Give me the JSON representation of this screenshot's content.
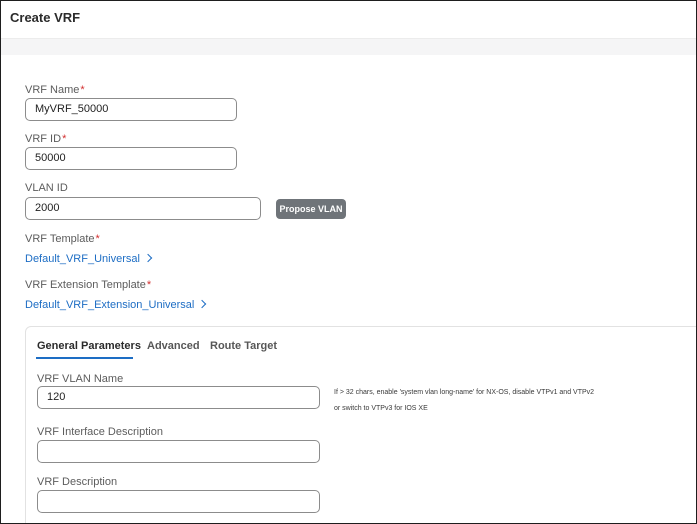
{
  "dialog": {
    "title": "Create VRF"
  },
  "form": {
    "vrf_name": {
      "label": "VRF Name",
      "required_mark": "*",
      "value": "MyVRF_50000"
    },
    "vrf_id": {
      "label": "VRF ID",
      "required_mark": "*",
      "value": "50000"
    },
    "vlan_id": {
      "label": "VLAN ID",
      "value": "2000"
    },
    "propose_vlan_button": "Propose VLAN",
    "vrf_template": {
      "label": "VRF Template",
      "required_mark": "*",
      "link": "Default_VRF_Universal"
    },
    "vrf_extension_template": {
      "label": "VRF Extension Template",
      "required_mark": "*",
      "link": "Default_VRF_Extension_Universal"
    }
  },
  "tabs": [
    {
      "label": "General Parameters",
      "active": true
    },
    {
      "label": "Advanced",
      "active": false
    },
    {
      "label": "Route Target",
      "active": false
    }
  ],
  "general": {
    "vrf_vlan_name": {
      "label": "VRF VLAN Name",
      "value": "120"
    },
    "vlan_name_hint_line1": "If > 32 chars, enable 'system vlan long-name' for NX-OS, disable VTPv1 and VTPv2",
    "vlan_name_hint_line2": "or switch to VTPv3 for IOS XE",
    "vrf_interface_description": {
      "label": "VRF Interface Description",
      "value": ""
    },
    "vrf_description": {
      "label": "VRF Description",
      "value": ""
    }
  },
  "colors": {
    "link": "#1d6dc4",
    "required": "#d32f2f",
    "button": "#6f7479",
    "tab_underline": "#1d6dc4"
  }
}
